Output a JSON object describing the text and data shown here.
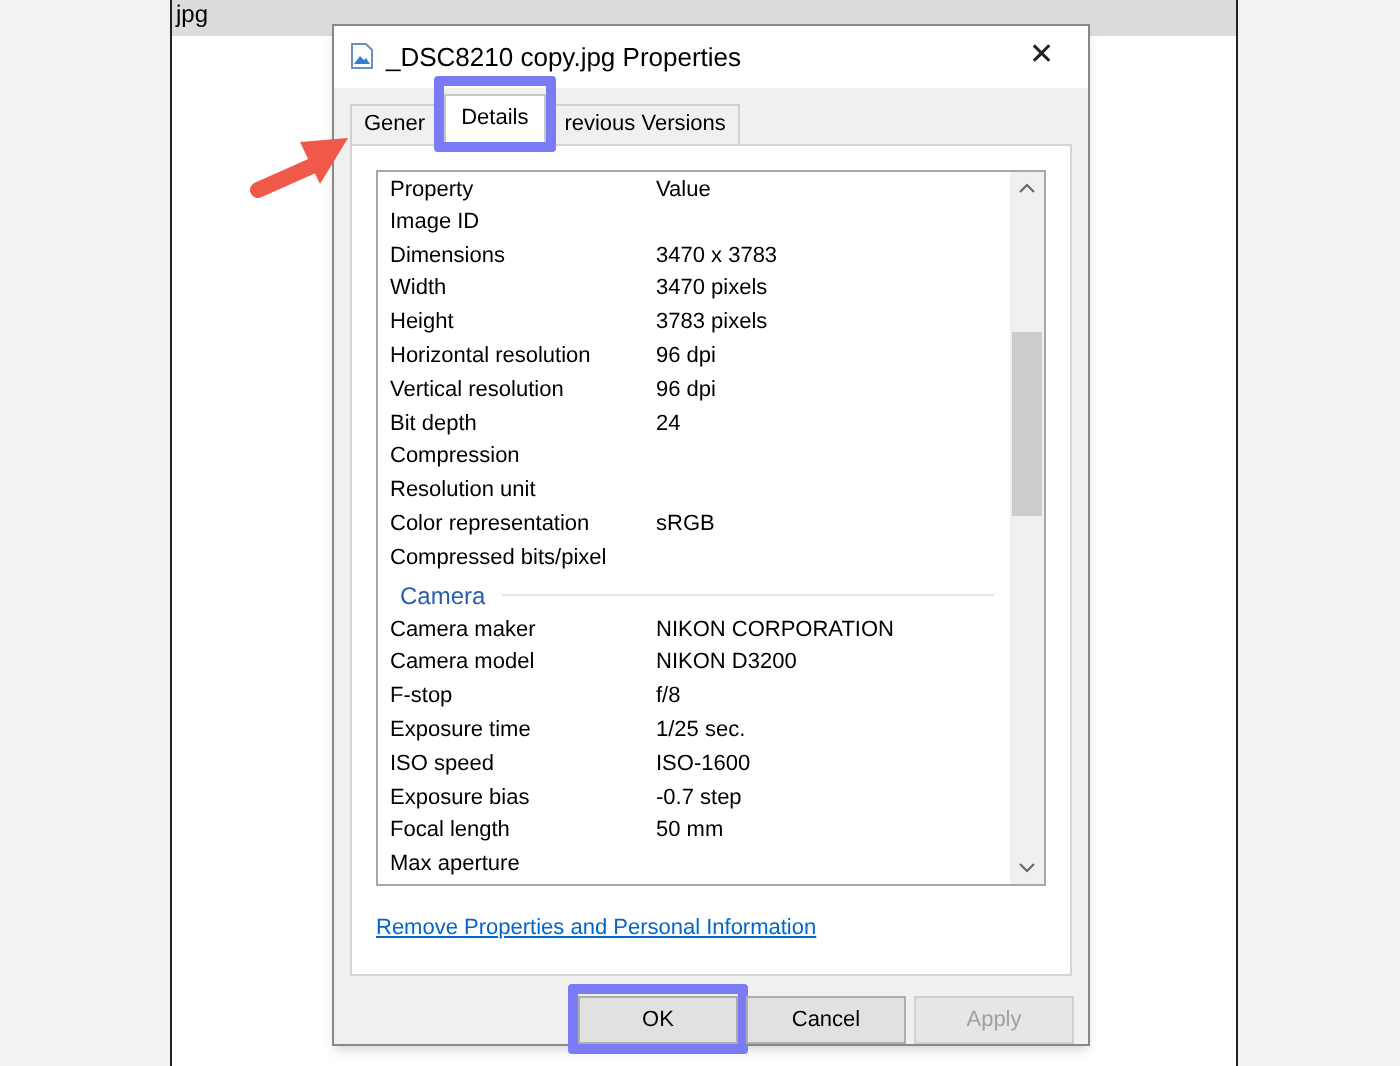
{
  "background": {
    "file_label": "jpg"
  },
  "window": {
    "title": "_DSC8210 copy.jpg Properties",
    "close": "✕"
  },
  "tabs": [
    {
      "label": "Gener",
      "selected": false,
      "highlighted": false
    },
    {
      "label": "Details",
      "selected": true,
      "highlighted": true
    },
    {
      "label": "revious Versions",
      "selected": false,
      "highlighted": false
    }
  ],
  "list": {
    "columns": [
      "Property",
      "Value"
    ],
    "rows": [
      {
        "kind": "row",
        "property": "Image ID"
      },
      {
        "kind": "row",
        "property": "Dimensions",
        "value": "3470 x 3783"
      },
      {
        "kind": "row",
        "property": "Width",
        "value": "3470 pixels"
      },
      {
        "kind": "row",
        "property": "Height",
        "value": "3783 pixels"
      },
      {
        "kind": "row",
        "property": "Horizontal resolution",
        "value": "96 dpi"
      },
      {
        "kind": "row",
        "property": "Vertical resolution",
        "value": "96 dpi"
      },
      {
        "kind": "row",
        "property": "Bit depth",
        "value": "24"
      },
      {
        "kind": "row",
        "property": "Compression"
      },
      {
        "kind": "row",
        "property": "Resolution unit"
      },
      {
        "kind": "row",
        "property": "Color representation",
        "value": "sRGB"
      },
      {
        "kind": "row",
        "property": "Compressed bits/pixel"
      },
      {
        "kind": "section",
        "property": "Camera"
      },
      {
        "kind": "row",
        "property": "Camera maker",
        "value": "NIKON CORPORATION"
      },
      {
        "kind": "row",
        "property": "Camera model",
        "value": "NIKON D3200"
      },
      {
        "kind": "row",
        "property": "F-stop",
        "value": "f/8"
      },
      {
        "kind": "row",
        "property": "Exposure time",
        "value": "1/25 sec."
      },
      {
        "kind": "row",
        "property": "ISO speed",
        "value": "ISO-1600"
      },
      {
        "kind": "row",
        "property": "Exposure bias",
        "value": "-0.7 step"
      },
      {
        "kind": "row",
        "property": "Focal length",
        "value": "50 mm"
      },
      {
        "kind": "row",
        "property": "Max aperture"
      }
    ]
  },
  "link": "Remove Properties and Personal Information",
  "buttons": [
    {
      "label": "OK",
      "disabled": false,
      "highlighted": true
    },
    {
      "label": "Cancel",
      "disabled": false,
      "highlighted": false
    },
    {
      "label": "Apply",
      "disabled": true,
      "highlighted": false
    }
  ]
}
